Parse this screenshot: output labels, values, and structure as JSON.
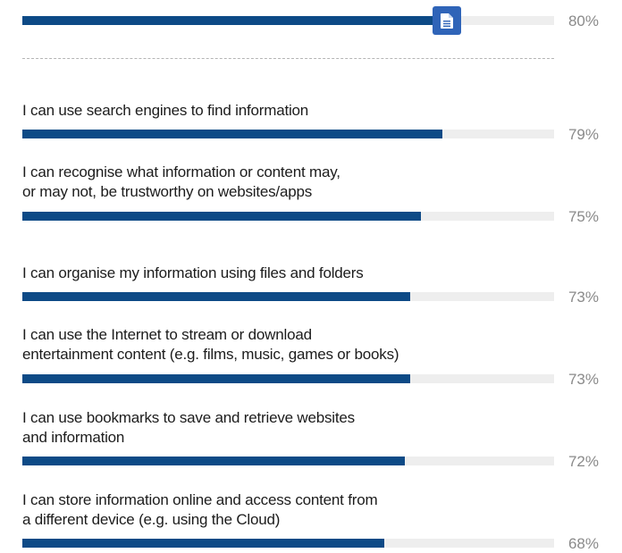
{
  "chart_data": {
    "type": "bar",
    "orientation": "horizontal",
    "value_unit": "%",
    "xlim": [
      0,
      100
    ],
    "grid": false,
    "bar_color": "#0d4a86",
    "track_color": "#eeeeee",
    "top_bar": {
      "label": "",
      "value": 80,
      "value_label": "80%"
    },
    "categories": [
      [
        "I can use search engines to find information"
      ],
      [
        "I can recognise what information or content may,",
        "or may not, be trustworthy on websites/apps"
      ],
      [
        "I can organise my information using files and folders"
      ],
      [
        "I can use the Internet to stream or download",
        "entertainment content (e.g. films, music, games or books)"
      ],
      [
        "I can use bookmarks to save and retrieve websites",
        "and information"
      ],
      [
        "I can store information online and access content from",
        "a different device (e.g. using the Cloud)"
      ]
    ],
    "values": [
      79,
      75,
      73,
      73,
      72,
      68
    ],
    "value_labels": [
      "79%",
      "75%",
      "73%",
      "73%",
      "72%",
      "68%"
    ]
  },
  "icons": {
    "badge": "document-icon",
    "badge_color": "#2f64b8"
  }
}
